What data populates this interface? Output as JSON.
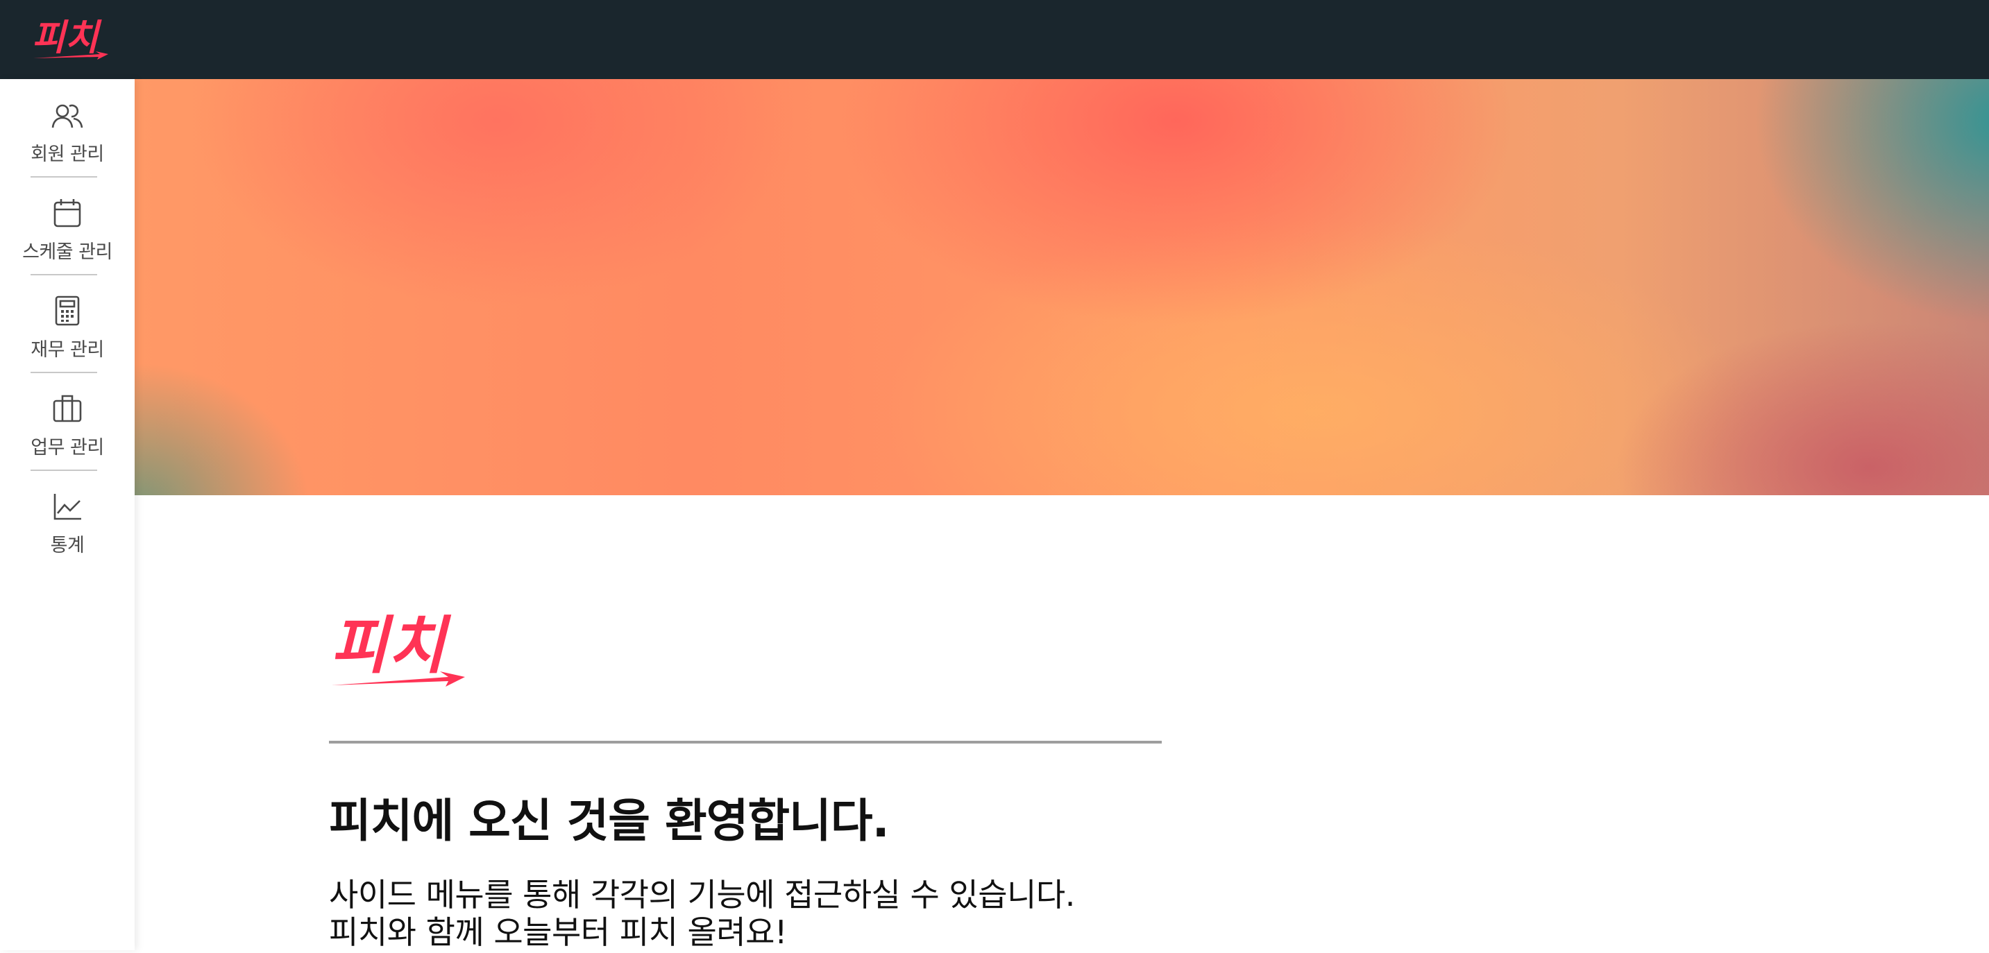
{
  "brand": {
    "logo_text": "피치",
    "accent_color": "#ff3355"
  },
  "colors": {
    "topbar": "#1a262d",
    "nav_text": "#4a4a4a",
    "divider": "#c8c8c8"
  },
  "sidebar": {
    "items": [
      {
        "label": "회원 관리",
        "icon": "users-icon"
      },
      {
        "label": "스케줄 관리",
        "icon": "calendar-icon"
      },
      {
        "label": "재무 관리",
        "icon": "calculator-icon"
      },
      {
        "label": "업무 관리",
        "icon": "briefcase-icon"
      },
      {
        "label": "통계",
        "icon": "chart-line-icon"
      }
    ]
  },
  "main": {
    "title": "피치에 오신 것을 환영합니다.",
    "lines": [
      "사이드 메뉴를 통해 각각의 기능에 접근하실 수 있습니다.",
      "피치와 함께 오늘부터 피치 올려요!"
    ]
  }
}
